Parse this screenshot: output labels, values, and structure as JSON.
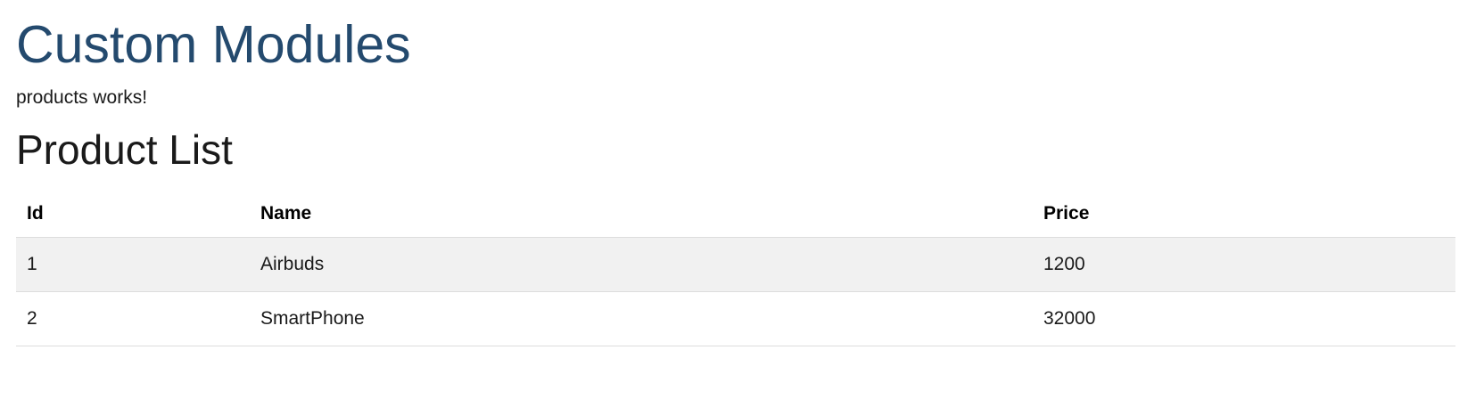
{
  "header": {
    "title": "Custom Modules"
  },
  "status": {
    "message": "products works!"
  },
  "product_list": {
    "title": "Product List",
    "columns": [
      "Id",
      "Name",
      "Price"
    ],
    "rows": [
      {
        "id": "1",
        "name": "Airbuds",
        "price": "1200"
      },
      {
        "id": "2",
        "name": "SmartPhone",
        "price": "32000"
      }
    ]
  },
  "colors": {
    "title": "#244a6e",
    "stripe": "#f1f1f1",
    "border": "#dddddd"
  }
}
